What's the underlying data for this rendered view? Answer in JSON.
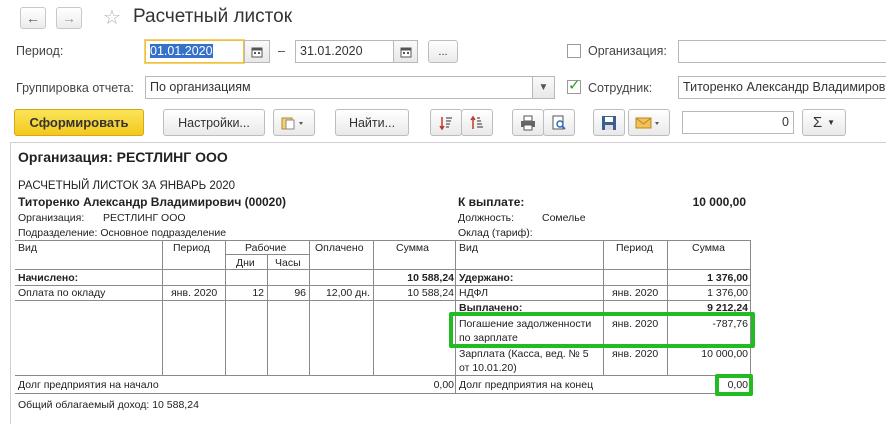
{
  "window": {
    "title": "Расчетный листок"
  },
  "filters": {
    "period_label": "Период:",
    "period_from": "01.01.2020",
    "period_dash": "–",
    "period_to": "31.01.2020",
    "more_button": "...",
    "organization_label": "Организация:",
    "organization_value": "",
    "grouping_label": "Группировка отчета:",
    "grouping_value": "По организациям",
    "employee_label": "Сотрудник:",
    "employee_value": "Титоренко Александр Владимиров"
  },
  "toolbar": {
    "generate": "Сформировать",
    "settings": "Настройки...",
    "find": "Найти...",
    "sum_value": "0",
    "sigma": "Σ"
  },
  "report": {
    "org_header": "Организация: РЕСТЛИНГ ООО",
    "payslip_title": "РАСЧЕТНЫЙ ЛИСТОК ЗА ЯНВАРЬ 2020",
    "employee_name": "Титоренко Александр Владимирович (00020)",
    "org_label": "Организация:",
    "org_value": "РЕСТЛИНГ ООО",
    "department": "Подразделение: Основное подразделение",
    "to_pay_label": "К выплате:",
    "to_pay_value": "10 000,00",
    "position_label": "Должность:",
    "position_value": "Сомелье",
    "salary_label": "Оклад (тариф):",
    "left_headers": {
      "type": "Вид",
      "period": "Период",
      "working": "Рабочие",
      "days": "Дни",
      "hours": "Часы",
      "paid": "Оплачено",
      "amount": "Сумма"
    },
    "right_headers": {
      "type": "Вид",
      "period": "Период",
      "amount": "Сумма"
    },
    "accrued_label": "Начислено:",
    "accrued_total": "10 588,24",
    "accrual_row": {
      "type": "Оплата по окладу",
      "period": "янв. 2020",
      "days": "12",
      "hours": "96",
      "paid": "12,00 дн.",
      "amount": "10 588,24"
    },
    "withheld_label": "Удержано:",
    "withheld_total": "1 376,00",
    "ndfl_row": {
      "type": "НДФЛ",
      "period": "янв. 2020",
      "amount": "1 376,00"
    },
    "paid_label": "Выплачено:",
    "paid_total": "9 212,24",
    "debt_row": {
      "type_line1": "Погашение задолженности",
      "type_line2": "по зарплате",
      "period": "янв. 2020",
      "amount": "-787,76"
    },
    "salary_row": {
      "type_line1": "Зарплата (Касса, вед. № 5",
      "type_line2": "от 10.01.20)",
      "period": "янв. 2020",
      "amount": "10 000,00"
    },
    "debt_start_label": "Долг предприятия на начало",
    "debt_start_value": "0,00",
    "debt_end_label": "Долг предприятия на конец",
    "debt_end_value": "0,00",
    "taxable_income": "Общий облагаемый доход: 10 588,24"
  },
  "colors": {
    "highlight": "#22bb22",
    "primary_button": "#f3c81b",
    "selection": "#3571c8"
  },
  "icons": [
    "back-arrow-icon",
    "forward-arrow-icon",
    "favorite-star-icon",
    "calendar-icon",
    "print-icon",
    "preview-icon",
    "save-icon",
    "mail-icon",
    "sort-desc-icon",
    "sort-asc-icon",
    "variant-icon"
  ]
}
